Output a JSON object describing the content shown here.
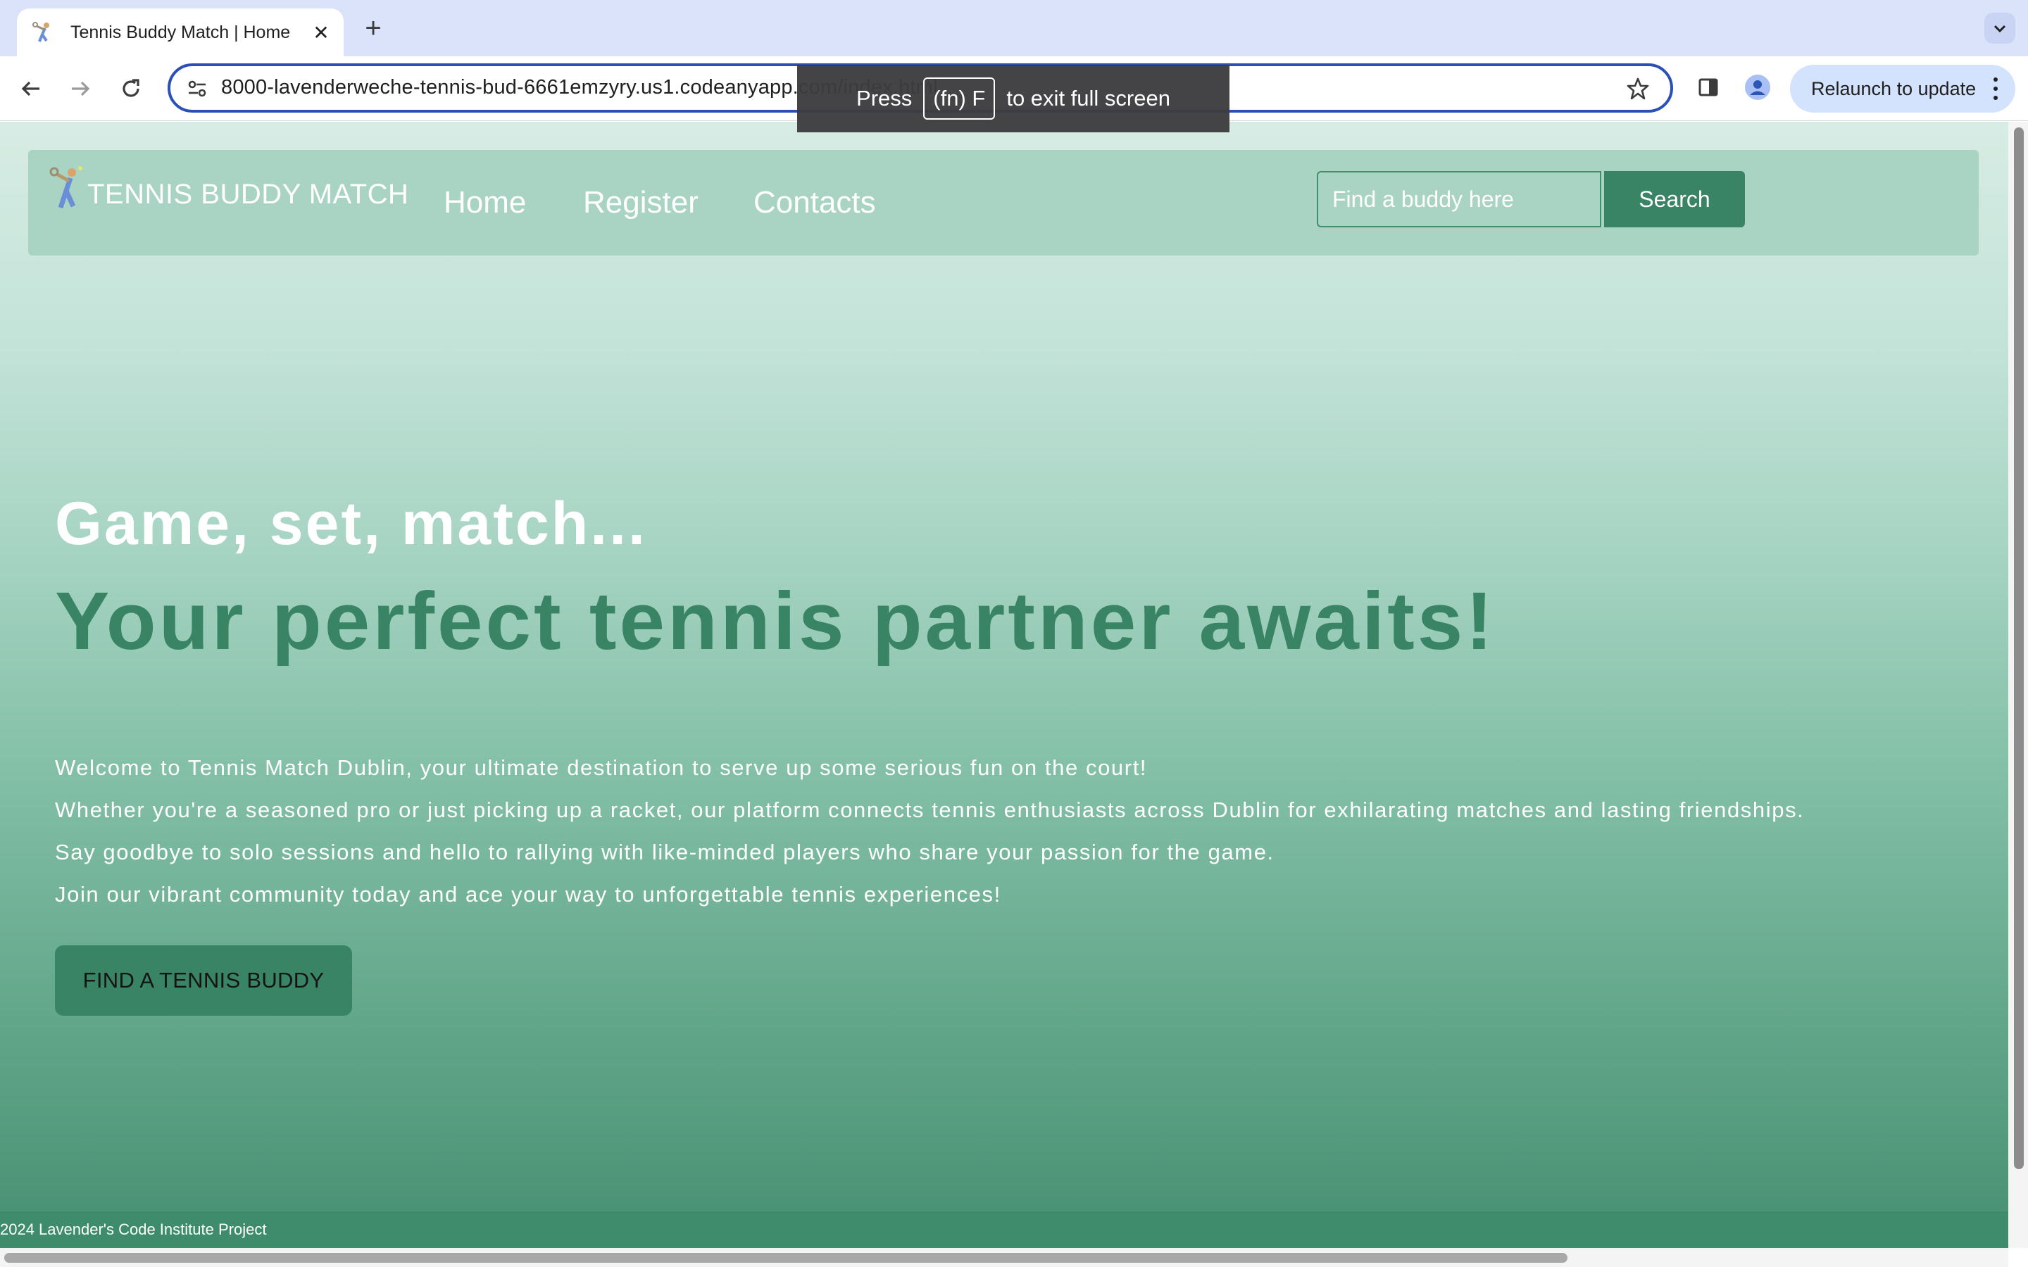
{
  "browser": {
    "tab": {
      "title": "Tennis Buddy Match | Home",
      "favicon": "tennis-player-icon",
      "close_icon": "close-icon"
    },
    "new_tab_icon": "plus-icon",
    "tab_search_icon": "chevron-down-icon",
    "nav": {
      "back_icon": "back-arrow-icon",
      "forward_icon": "forward-arrow-icon",
      "reload_icon": "reload-icon"
    },
    "address_bar": {
      "url": "8000-lavenderweche-tennis-bud-6661emzyry.us1.codeanyapp.com/index.html",
      "site_info_icon": "tune-icon",
      "bookmark_icon": "star-icon"
    },
    "side_panel_icon": "side-panel-icon",
    "profile_icon": "profile-icon",
    "relaunch_label": "Relaunch to update",
    "menu_icon": "kebab-menu-icon"
  },
  "fullscreen_toast": {
    "press": "Press",
    "key": "(fn) F",
    "suffix": "to exit full screen"
  },
  "site": {
    "brand": "TENNIS BUDDY MATCH",
    "nav_links": [
      "Home",
      "Register",
      "Contacts"
    ],
    "search": {
      "placeholder": "Find a buddy here",
      "button_label": "Search"
    },
    "hero": {
      "subtitle": "Game, set, match...",
      "title": "Your perfect tennis partner awaits!",
      "paragraphs": [
        "Welcome to Tennis Match Dublin, your ultimate destination to serve up some serious fun on the court!",
        "Whether you're a seasoned pro or just picking up a racket, our platform connects tennis enthusiasts across Dublin for exhilarating matches and lasting friendships.",
        "Say goodbye to solo sessions and hello to rallying with like-minded players who share your passion for the game.",
        "Join our vibrant community today and ace your way to unforgettable tennis experiences!"
      ],
      "cta_label": "FIND A TENNIS BUDDY"
    },
    "footer": "2024 Lavender's Code Institute Project"
  },
  "colors": {
    "accent": "#3a8466",
    "navbar": "#a9d3c3",
    "chrome_tabstrip": "#dbe3fb",
    "omnibox_border": "#2a4fb6"
  }
}
